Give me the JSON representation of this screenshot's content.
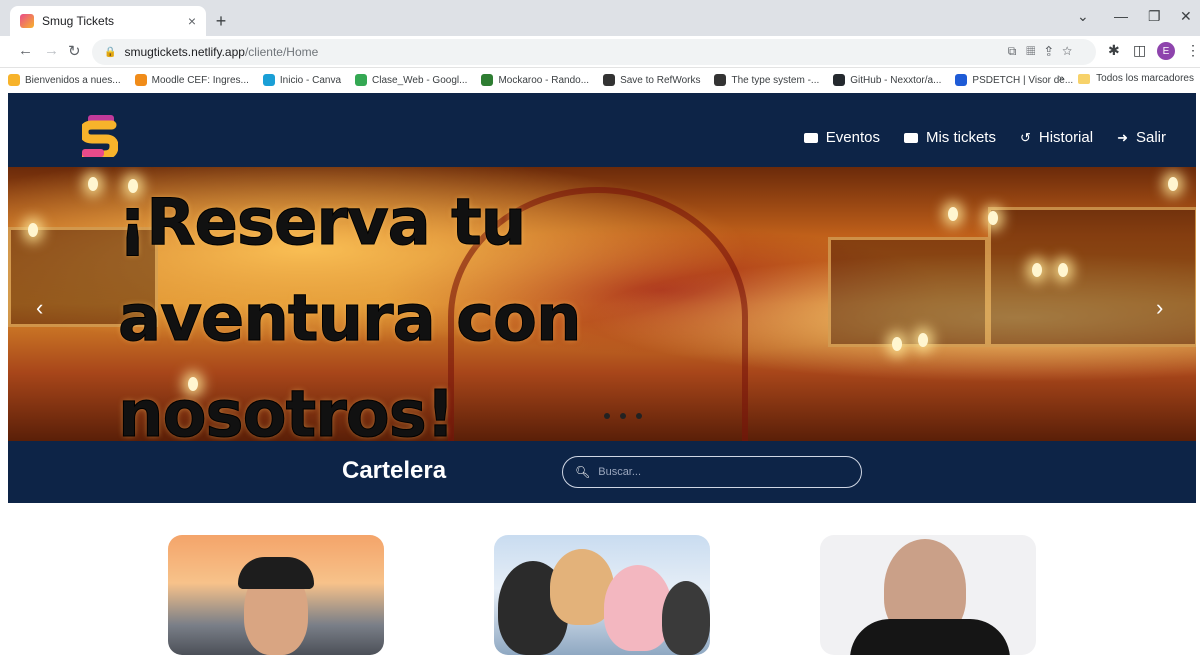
{
  "browser": {
    "tab_title": "Smug Tickets",
    "tab_close": "×",
    "new_tab": "+",
    "url_host": "smugtickets.netlify.app",
    "url_path": "/cliente/Home",
    "profile_initial": "E",
    "bookmarks": [
      {
        "label": "Bienvenidos a nues...",
        "color": "#f7b32b"
      },
      {
        "label": "Moodle CEF: Ingres...",
        "color": "#f08c1a"
      },
      {
        "label": "Inicio - Canva",
        "color": "#1a9fd6"
      },
      {
        "label": "Clase_Web - Googl...",
        "color": "#34a853"
      },
      {
        "label": "Mockaroo - Rando...",
        "color": "#2e7d32"
      },
      {
        "label": "Save to RefWorks",
        "color": "#333333"
      },
      {
        "label": "The type system -...",
        "color": "#333333"
      },
      {
        "label": "GitHub - Nexxtor/a...",
        "color": "#24292e"
      },
      {
        "label": "PSDETCH | Visor de...",
        "color": "#1e5bd6"
      }
    ],
    "bookmarks_overflow": "»",
    "all_bookmarks": "Todos los marcadores"
  },
  "nav": {
    "items": [
      {
        "label": "Eventos",
        "icon": "ticket-icon"
      },
      {
        "label": "Mis tickets",
        "icon": "ticket-icon"
      },
      {
        "label": "Historial",
        "icon": "history-icon"
      },
      {
        "label": "Salir",
        "icon": "logout-icon"
      }
    ]
  },
  "hero": {
    "headline": "¡Reserva tu aventura con nosotros!",
    "prev": "‹",
    "next": "›"
  },
  "cartelera": {
    "title": "Cartelera",
    "search_placeholder": "Buscar..."
  },
  "colors": {
    "navy": "#0d2447",
    "logo_pink": "#e94b8a",
    "logo_yellow": "#f7b32b"
  }
}
